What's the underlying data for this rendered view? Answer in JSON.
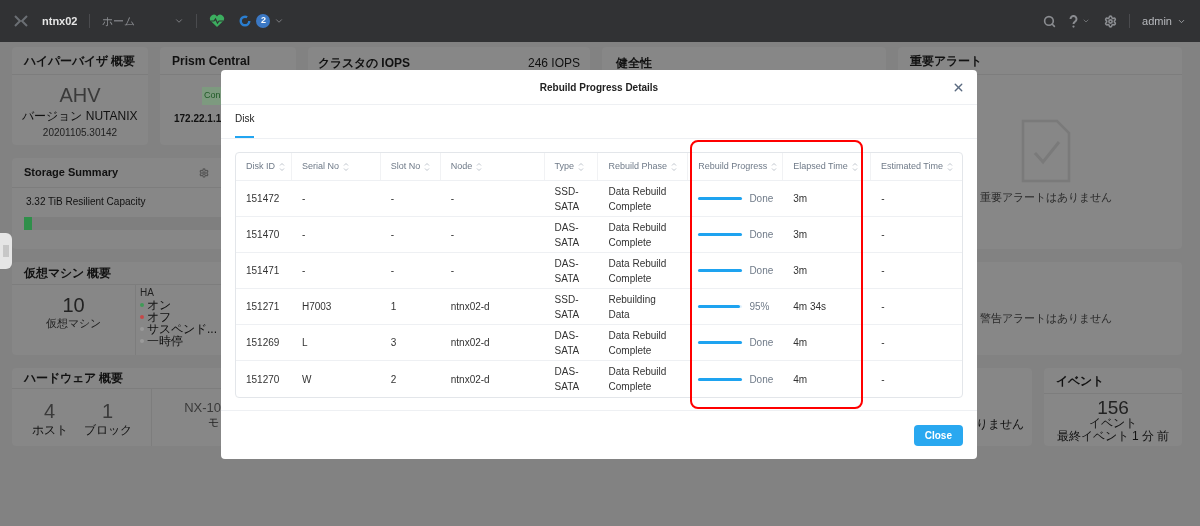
{
  "topbar": {
    "cluster": "ntnx02",
    "view": "ホーム",
    "alert_count": "2",
    "user": "admin"
  },
  "dashboard": {
    "hypervisor": {
      "title": "ハイパーバイザ 概要",
      "name": "AHV",
      "version": "バージョン NUTANIX",
      "build": "20201105.30142"
    },
    "prism": {
      "title": "Prism Central",
      "status": "Con",
      "ip": "172.22.1.1"
    },
    "iops": {
      "title": "クラスタの IOPS",
      "value": "246 IOPS"
    },
    "health": {
      "title": "健全性"
    },
    "critical": {
      "title": "重要アラート",
      "message": "重要アラートはありません"
    },
    "storage": {
      "title": "Storage Summary",
      "capacity": "3.32 TiB Resilient Capacity",
      "level": 0.015
    },
    "vms": {
      "title": "仮想マシン 概要",
      "count": "10",
      "unit": "仮想マシン",
      "ha_label": "HA",
      "ha_items": [
        {
          "label": "オン",
          "color": "#3f9a57"
        },
        {
          "label": "オフ",
          "color": "#c44848"
        },
        {
          "label": "サスペンド...",
          "color": "#9a9a9a"
        },
        {
          "label": "一時停",
          "color": "#9a9a9a"
        }
      ]
    },
    "warning": {
      "message": "警告アラートはありません"
    },
    "hardware": {
      "title": "ハードウェア 概要",
      "hosts": "4",
      "hosts_label": "ホスト",
      "blocks": "1",
      "blocks_label": "ブロック",
      "model": "NX-10",
      "model_label": "モ"
    },
    "alerts_partial": {
      "message": "りません"
    },
    "events": {
      "title": "イベント",
      "count": "156",
      "unit": "イベント",
      "last": "最終イベント 1 分 前"
    }
  },
  "modal": {
    "title": "Rebuild Progress Details",
    "tabs": [
      {
        "label": "Disk",
        "selected": true
      }
    ],
    "columns": [
      "Disk ID",
      "Serial No",
      "Slot No",
      "Node",
      "Type",
      "Rebuild Phase",
      "Rebuild Progress",
      "Elapsed Time",
      "Estimated Time"
    ],
    "rows": [
      {
        "disk_id": "151472",
        "serial": "-",
        "slot": "-",
        "node": "-",
        "type": "SSD-SATA",
        "phase": "Data Rebuild Complete",
        "level": 1,
        "progress": "Done",
        "elapsed": "3m",
        "estimated": "-"
      },
      {
        "disk_id": "151470",
        "serial": "-",
        "slot": "-",
        "node": "-",
        "type": "DAS-SATA",
        "phase": "Data Rebuild Complete",
        "level": 1,
        "progress": "Done",
        "elapsed": "3m",
        "estimated": "-"
      },
      {
        "disk_id": "151471",
        "serial": "-",
        "slot": "-",
        "node": "-",
        "type": "DAS-SATA",
        "phase": "Data Rebuild Complete",
        "level": 1,
        "progress": "Done",
        "elapsed": "3m",
        "estimated": "-"
      },
      {
        "disk_id": "151271",
        "serial": "H7003",
        "slot": "1",
        "node": "ntnx02-d",
        "type": "SSD-SATA",
        "phase": "Rebuilding Data",
        "level": 0.95,
        "progress": "95%",
        "elapsed": "4m 34s",
        "estimated": "-"
      },
      {
        "disk_id": "151269",
        "serial": "L",
        "slot": "3",
        "node": "ntnx02-d",
        "type": "DAS-SATA",
        "phase": "Data Rebuild Complete",
        "level": 1,
        "progress": "Done",
        "elapsed": "4m",
        "estimated": "-"
      },
      {
        "disk_id": "151270",
        "serial": "W",
        "slot": "2",
        "node": "ntnx02-d",
        "type": "DAS-SATA",
        "phase": "Data Rebuild Complete",
        "level": 1,
        "progress": "Done",
        "elapsed": "4m",
        "estimated": "-"
      }
    ],
    "close": "Close",
    "highlight": true
  }
}
